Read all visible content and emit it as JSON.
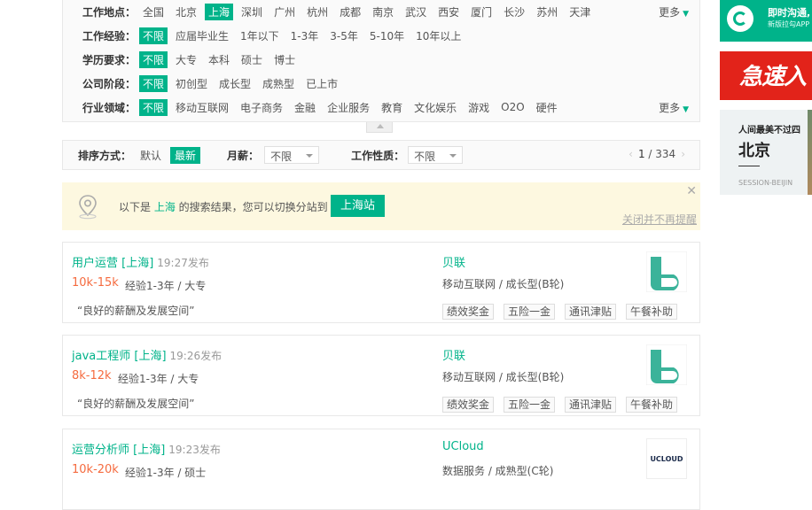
{
  "filters": {
    "location": {
      "label": "工作地点：",
      "options": [
        "全国",
        "北京",
        "上海",
        "深圳",
        "广州",
        "杭州",
        "成都",
        "南京",
        "武汉",
        "西安",
        "厦门",
        "长沙",
        "苏州",
        "天津"
      ],
      "selected": "上海",
      "more": "更多"
    },
    "experience": {
      "label": "工作经验：",
      "options": [
        "不限",
        "应届毕业生",
        "1年以下",
        "1-3年",
        "3-5年",
        "5-10年",
        "10年以上"
      ],
      "selected": "不限"
    },
    "education": {
      "label": "学历要求：",
      "options": [
        "不限",
        "大专",
        "本科",
        "硕士",
        "博士"
      ],
      "selected": "不限"
    },
    "stage": {
      "label": "公司阶段：",
      "options": [
        "不限",
        "初创型",
        "成长型",
        "成熟型",
        "已上市"
      ],
      "selected": "不限"
    },
    "industry": {
      "label": "行业领域：",
      "options": [
        "不限",
        "移动互联网",
        "电子商务",
        "金融",
        "企业服务",
        "教育",
        "文化娱乐",
        "游戏",
        "O2O",
        "硬件"
      ],
      "selected": "不限",
      "more": "更多"
    }
  },
  "sort_bar": {
    "sort_label": "排序方式：",
    "sort_default": "默认",
    "sort_newest": "最新",
    "salary_label": "月薪：",
    "salary_value": "不限",
    "nature_label": "工作性质：",
    "nature_value": "不限",
    "page_current": "1",
    "page_sep": " / ",
    "page_total": "334"
  },
  "notice": {
    "prefix": "以下是 ",
    "city": "上海",
    "suffix": " 的搜索结果，您可以切换分站到",
    "button": "上海站",
    "dismiss": "关闭并不再提醒"
  },
  "jobs": [
    {
      "title": "用户运营 [上海]",
      "time": "19:27发布",
      "salary": "10k-15k",
      "requirements": "经验1-3年 / 大专",
      "quote": "“良好的薪酬及发展空间”",
      "company": "贝联",
      "industry": "移动互联网 / 成长型(B轮)",
      "tags": [
        "绩效奖金",
        "五险一金",
        "通讯津贴",
        "午餐补助"
      ]
    },
    {
      "title": "java工程师 [上海]",
      "time": "19:26发布",
      "salary": "8k-12k",
      "requirements": "经验1-3年 / 大专",
      "quote": "“良好的薪酬及发展空间”",
      "company": "贝联",
      "industry": "移动互联网 / 成长型(B轮)",
      "tags": [
        "绩效奖金",
        "五险一金",
        "通讯津贴",
        "午餐补助"
      ]
    },
    {
      "title": "运营分析师 [上海]",
      "time": "19:23发布",
      "salary": "10k-20k",
      "requirements": "经验1-3年 / 硕士",
      "company": "UCloud",
      "industry": "数据服务 / 成熟型(C轮)",
      "logo_text": "UCLOUD"
    }
  ],
  "ads": {
    "app_title": "即时沟通,",
    "app_subtitle": "新版拉勾APP",
    "fast_text": "急速入",
    "city_line1": "人间最美不过四",
    "city_name": "北京",
    "city_en": "SESSION-BEIJIN"
  },
  "colors": {
    "accent": "#00b38a",
    "salary": "#f56b3f",
    "notice_bg": "#fdf8e0"
  }
}
